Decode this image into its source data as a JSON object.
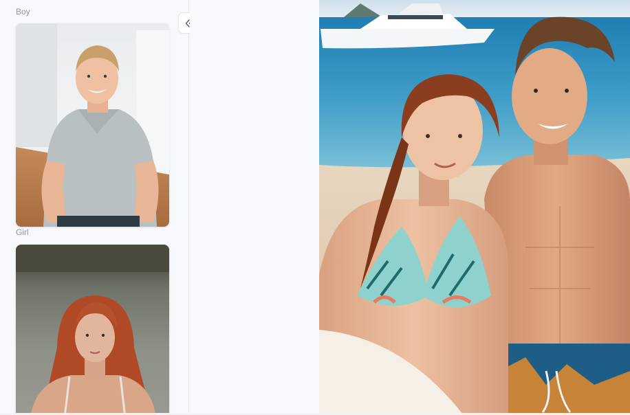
{
  "sidebar": {
    "sections": [
      {
        "label": "Boy",
        "image": "boy-photo"
      },
      {
        "label": "Girl",
        "image": "girl-photo"
      }
    ],
    "collapse_button": {
      "icon": "double-chevron-left-icon"
    }
  },
  "result": {
    "image": "generated-couple-beach-photo"
  },
  "colors": {
    "page_background": "#f7f9fc",
    "label_text": "#8e96a3",
    "border": "#e6e9ef"
  }
}
